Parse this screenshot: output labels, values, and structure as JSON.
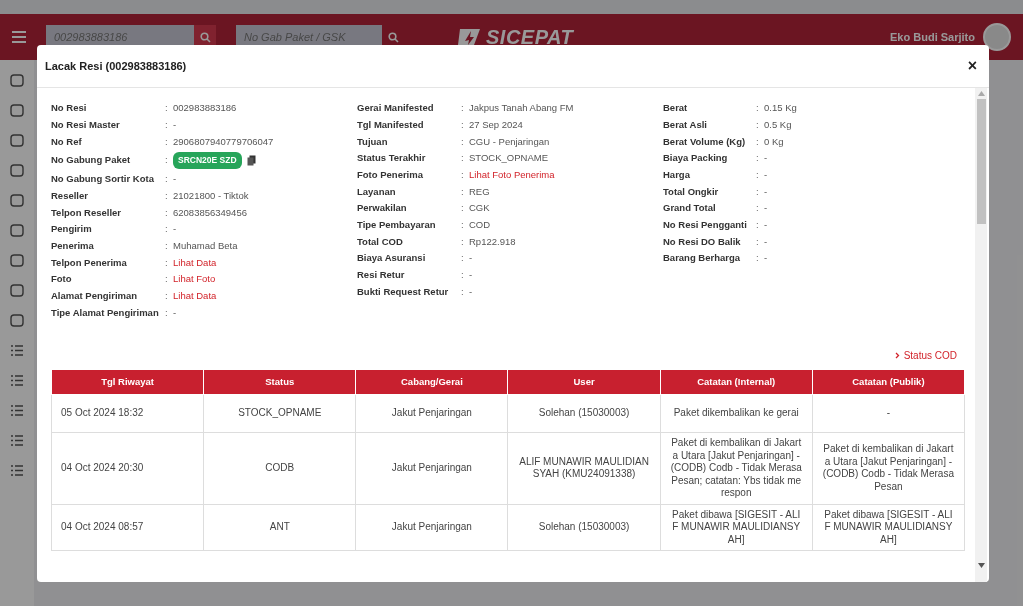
{
  "topbar": {
    "search_resi": {
      "placeholder": "002983883186"
    },
    "search_gabung": {
      "placeholder": "No Gab Paket / GSK"
    },
    "logo": "SICEPAT",
    "user": "Eko Budi Sarjito"
  },
  "modal": {
    "title": "Lacak Resi (002983883186)",
    "close": "×",
    "separator": ":",
    "details": [
      [
        {
          "label": "No Resi",
          "value": "002983883186",
          "kind": "text"
        },
        {
          "label": "No Resi Master",
          "value": "-",
          "kind": "text"
        },
        {
          "label": "No Ref",
          "value": "2906807940779706047",
          "kind": "text"
        },
        {
          "label": "No Gabung Paket",
          "value": "SRCN20E SZD",
          "kind": "badge"
        },
        {
          "label": "No Gabung Sortir Kota",
          "value": "-",
          "kind": "text"
        },
        {
          "label": "Reseller",
          "value": "21021800 - Tiktok",
          "kind": "text"
        },
        {
          "label": "Telpon Reseller",
          "value": "62083856349456",
          "kind": "text"
        },
        {
          "label": "Pengirim",
          "value": "-",
          "kind": "text"
        },
        {
          "label": "Penerima",
          "value": "Muhamad Beta",
          "kind": "text"
        },
        {
          "label": "Telpon Penerima",
          "value": "Lihat Data",
          "kind": "link"
        },
        {
          "label": "Foto",
          "value": "Lihat Foto",
          "kind": "link"
        },
        {
          "label": "Alamat Pengiriman",
          "value": "Lihat Data",
          "kind": "link"
        },
        {
          "label": "Tipe Alamat Pengiriman",
          "value": "-",
          "kind": "text"
        }
      ],
      [
        {
          "label": "Gerai Manifested",
          "value": "Jakpus Tanah Abang FM",
          "kind": "text"
        },
        {
          "label": "Tgl Manifested",
          "value": "27 Sep 2024",
          "kind": "text"
        },
        {
          "label": "Tujuan",
          "value": "CGU - Penjaringan",
          "kind": "text"
        },
        {
          "label": "Status Terakhir",
          "value": "STOCK_OPNAME",
          "kind": "text"
        },
        {
          "label": "Foto Penerima",
          "value": "Lihat Foto Penerima",
          "kind": "link"
        },
        {
          "label": "Layanan",
          "value": "REG",
          "kind": "text"
        },
        {
          "label": "Perwakilan",
          "value": "CGK",
          "kind": "text"
        },
        {
          "label": "Tipe Pembayaran",
          "value": "COD",
          "kind": "text"
        },
        {
          "label": "Total COD",
          "value": "Rp122.918",
          "kind": "text"
        },
        {
          "label": "Biaya Asuransi",
          "value": "-",
          "kind": "text"
        },
        {
          "label": "Resi Retur",
          "value": "-",
          "kind": "text"
        },
        {
          "label": "Bukti Request Retur",
          "value": "-",
          "kind": "text"
        }
      ],
      [
        {
          "label": "Berat",
          "value": "0.15 Kg",
          "kind": "text"
        },
        {
          "label": "Berat Asli",
          "value": "0.5 Kg",
          "kind": "text"
        },
        {
          "label": "Berat Volume (Kg)",
          "value": "0 Kg",
          "kind": "text"
        },
        {
          "label": "Biaya Packing",
          "value": "-",
          "kind": "text"
        },
        {
          "label": "Harga",
          "value": "-",
          "kind": "text"
        },
        {
          "label": "Total Ongkir",
          "value": "-",
          "kind": "text"
        },
        {
          "label": "Grand Total",
          "value": "-",
          "kind": "text"
        },
        {
          "label": "No Resi Pengganti",
          "value": "-",
          "kind": "text"
        },
        {
          "label": "No Resi DO Balik",
          "value": "-",
          "kind": "text"
        },
        {
          "label": "Barang Berharga",
          "value": "-",
          "kind": "text"
        }
      ]
    ],
    "status_cod_link": "Status COD",
    "table": {
      "columns": [
        "Tgl Riwayat",
        "Status",
        "Cabang/Gerai",
        "User",
        "Catatan (Internal)",
        "Catatan (Publik)"
      ],
      "rows": [
        [
          "05 Oct 2024 18:32",
          "STOCK_OPNAME",
          "Jakut Penjaringan",
          "Solehan (15030003)",
          "Paket dikembalikan ke gerai",
          "-"
        ],
        [
          "04 Oct 2024 20:30",
          "CODB",
          "Jakut Penjaringan",
          "ALIF MUNAWIR MAULIDIANSYAH (KMU24091338)",
          "Paket di kembalikan di Jakarta Utara [Jakut Penjaringan] - (CODB) Codb - Tidak Merasa Pesan; catatan: Ybs tidak merespon",
          "Paket di kembalikan di Jakarta Utara [Jakut Penjaringan] - (CODB) Codb - Tidak Merasa Pesan"
        ],
        [
          "04 Oct 2024 08:57",
          "ANT",
          "Jakut Penjaringan",
          "Solehan (15030003)",
          "Paket dibawa [SIGESIT - ALIF MUNAWIR MAULIDIANSYAH]",
          "Paket dibawa [SIGESIT - ALIF MUNAWIR MAULIDIANSYAH]"
        ]
      ]
    }
  }
}
